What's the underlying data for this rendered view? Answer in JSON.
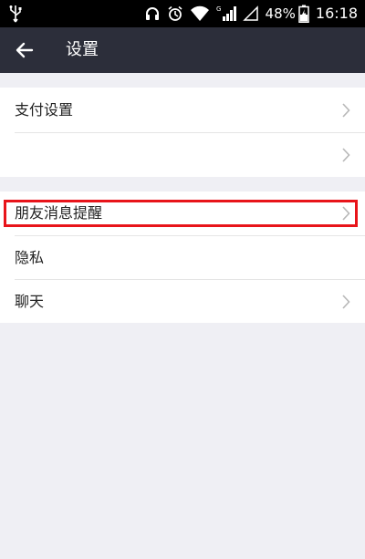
{
  "status_bar": {
    "icons": [
      "usb-icon",
      "headphones-icon",
      "alarm-icon",
      "wifi-icon",
      "signal-icon",
      "signal-empty-icon",
      "battery-icon"
    ],
    "network_label": "G",
    "battery": "48%",
    "time": "16:18"
  },
  "nav": {
    "title": "设置"
  },
  "settings": {
    "group1": [
      {
        "label": "支付设置"
      },
      {
        "label": ""
      }
    ],
    "group2": [
      {
        "label": "朋友消息提醒"
      },
      {
        "label": "隐私"
      },
      {
        "label": "聊天"
      }
    ]
  },
  "colors": {
    "nav_bg": "#2c2e3a",
    "page_bg": "#efeff4",
    "highlight": "#e8141a"
  }
}
